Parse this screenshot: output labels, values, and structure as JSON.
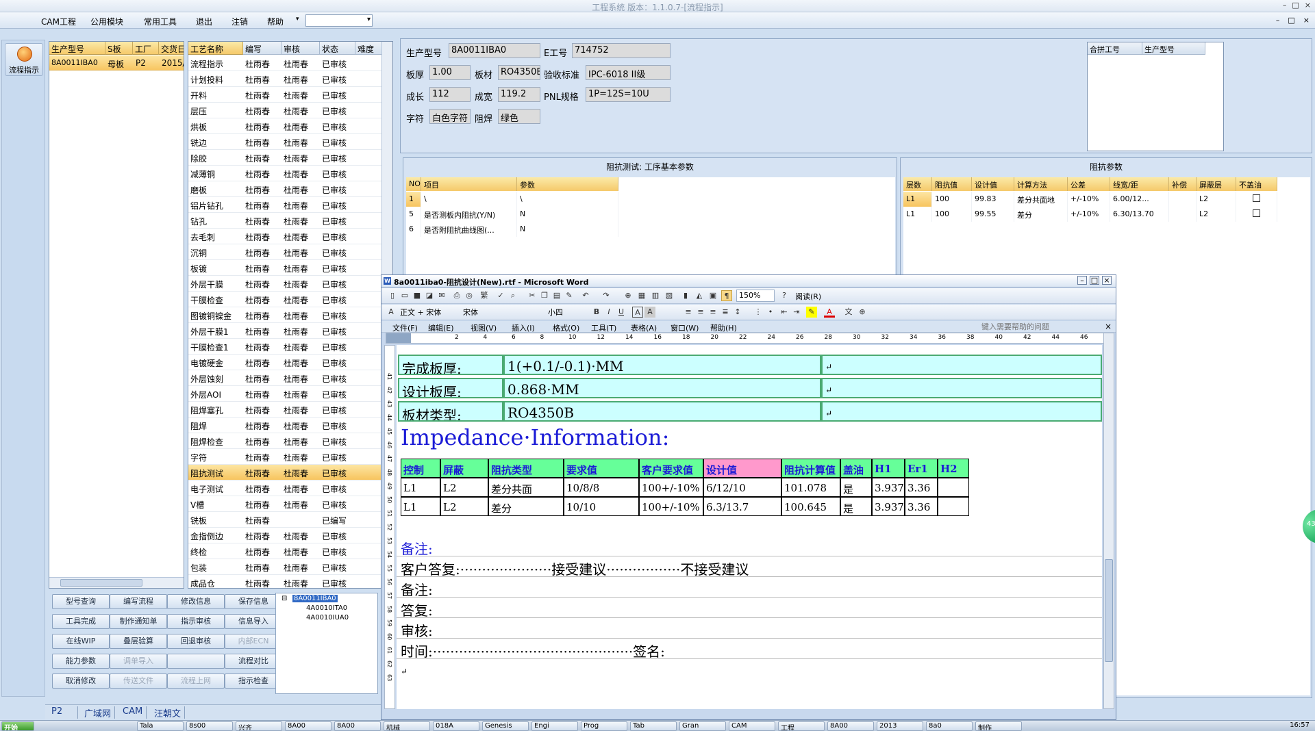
{
  "window": {
    "title": "工程系统 版本：1.1.0.7-[流程指示]",
    "controls": [
      "–",
      "□",
      "×"
    ]
  },
  "menu": {
    "items": [
      "CAM工程",
      "公用模块",
      "常用工具",
      "退出",
      "注销",
      "帮助"
    ],
    "combo_arrow": "▾",
    "mdi_controls": [
      "–",
      "□",
      "×"
    ]
  },
  "left_toolbar": {
    "flow_label": "流程指示"
  },
  "product_grid": {
    "headers": [
      "生产型号",
      "S板",
      "工厂",
      "交货日"
    ],
    "rows": [
      [
        "8A0011IBA0",
        "母板",
        "P2",
        "2015/"
      ]
    ]
  },
  "process_grid": {
    "headers": [
      "工艺名称",
      "编写",
      "审核",
      "状态",
      "难度"
    ],
    "rows": [
      [
        "流程指示",
        "杜雨春",
        "杜雨春",
        "已审核"
      ],
      [
        "计划投料",
        "杜雨春",
        "杜雨春",
        "已审核"
      ],
      [
        "开料",
        "杜雨春",
        "杜雨春",
        "已审核"
      ],
      [
        "层压",
        "杜雨春",
        "杜雨春",
        "已审核"
      ],
      [
        "烘板",
        "杜雨春",
        "杜雨春",
        "已审核"
      ],
      [
        "铣边",
        "杜雨春",
        "杜雨春",
        "已审核"
      ],
      [
        "除胶",
        "杜雨春",
        "杜雨春",
        "已审核"
      ],
      [
        "减薄铜",
        "杜雨春",
        "杜雨春",
        "已审核"
      ],
      [
        "磨板",
        "杜雨春",
        "杜雨春",
        "已审核"
      ],
      [
        "铝片钻孔",
        "杜雨春",
        "杜雨春",
        "已审核"
      ],
      [
        "钻孔",
        "杜雨春",
        "杜雨春",
        "已审核"
      ],
      [
        "去毛刺",
        "杜雨春",
        "杜雨春",
        "已审核"
      ],
      [
        "沉铜",
        "杜雨春",
        "杜雨春",
        "已审核"
      ],
      [
        "板镀",
        "杜雨春",
        "杜雨春",
        "已审核"
      ],
      [
        "外层干膜",
        "杜雨春",
        "杜雨春",
        "已审核"
      ],
      [
        "干膜检查",
        "杜雨春",
        "杜雨春",
        "已审核"
      ],
      [
        "图镀铜镍金",
        "杜雨春",
        "杜雨春",
        "已审核"
      ],
      [
        "外层干膜1",
        "杜雨春",
        "杜雨春",
        "已审核"
      ],
      [
        "干膜检查1",
        "杜雨春",
        "杜雨春",
        "已审核"
      ],
      [
        "电镀硬金",
        "杜雨春",
        "杜雨春",
        "已审核"
      ],
      [
        "外层蚀刻",
        "杜雨春",
        "杜雨春",
        "已审核"
      ],
      [
        "外层AOI",
        "杜雨春",
        "杜雨春",
        "已审核"
      ],
      [
        "阻焊塞孔",
        "杜雨春",
        "杜雨春",
        "已审核"
      ],
      [
        "阻焊",
        "杜雨春",
        "杜雨春",
        "已审核"
      ],
      [
        "阻焊检查",
        "杜雨春",
        "杜雨春",
        "已审核"
      ],
      [
        "字符",
        "杜雨春",
        "杜雨春",
        "已审核"
      ],
      [
        "阻抗测试",
        "杜雨春",
        "杜雨春",
        "已审核"
      ],
      [
        "电子测试",
        "杜雨春",
        "杜雨春",
        "已审核"
      ],
      [
        "V槽",
        "杜雨春",
        "杜雨春",
        "已审核"
      ],
      [
        "铣板",
        "杜雨春",
        "",
        "已编写"
      ],
      [
        "金指倒边",
        "杜雨春",
        "杜雨春",
        "已审核"
      ],
      [
        "终检",
        "杜雨春",
        "杜雨春",
        "已审核"
      ],
      [
        "包装",
        "杜雨春",
        "杜雨春",
        "已审核"
      ],
      [
        "成品仓",
        "杜雨春",
        "杜雨春",
        "已审核"
      ]
    ],
    "selected_index": 26
  },
  "buttons": [
    [
      "型号查询",
      "编写流程",
      "修改信息",
      "保存信息"
    ],
    [
      "工具完成",
      "制作通知单",
      "指示审核",
      "信息导入"
    ],
    [
      "在线WIP",
      "叠层验算",
      "回退审核",
      "内部ECN"
    ],
    [
      "能力参数",
      "调单导入",
      "",
      "流程对比"
    ],
    [
      "取消修改",
      "传送文件",
      "流程上网",
      "指示检查"
    ]
  ],
  "disabled_buttons": [
    "内部ECN",
    "调单导入",
    "",
    "传送文件",
    "流程上网"
  ],
  "tree": {
    "root": "8A0011IBA0",
    "children": [
      "4A0010ITA0",
      "4A0010IUA0"
    ],
    "toggle": "⊟"
  },
  "bottom_tabs": [
    "P2",
    "广域网",
    "CAM",
    "汪朝文"
  ],
  "info": {
    "product_label": "生产型号",
    "product_value": "8A0011IBA0",
    "eno_label": "E工号",
    "eno_value": "714752",
    "thickness_label": "板厚",
    "thickness_value": "1.00",
    "material_label": "板材",
    "material_value": "RO4350B",
    "std_label": "验收标准",
    "std_value": "IPC-6018 II级",
    "len_label": "成长",
    "len_value": "112",
    "wid_label": "成宽",
    "wid_value": "119.2",
    "pnl_label": "PNL规格",
    "pnl_value": "1P=12S=10U",
    "char_label": "字符",
    "char_value": "白色字符",
    "mask_label": "阻焊",
    "mask_value": "绿色"
  },
  "merge_grid": {
    "headers": [
      "合拼工号",
      "生产型号"
    ]
  },
  "base_params": {
    "title": "阻抗测试: 工序基本参数",
    "headers": [
      "NO",
      "项目",
      "参数"
    ],
    "rows": [
      [
        "1",
        "\\",
        "\\"
      ],
      [
        "5",
        "是否测板内阻抗(Y/N)",
        "N"
      ],
      [
        "6",
        "是否附阻抗曲线图(...",
        "N"
      ]
    ]
  },
  "impedance_params": {
    "title": "阻抗参数",
    "headers": [
      "层数",
      "阻抗值",
      "设计值",
      "计算方法",
      "公差",
      "线宽/距",
      "补偿",
      "屏蔽层",
      "不盖油"
    ],
    "rows": [
      [
        "L1",
        "100",
        "99.83",
        "差分共面地",
        "+/-10%",
        "6.00/12...",
        "",
        "L2"
      ],
      [
        "L1",
        "100",
        "99.55",
        "差分",
        "+/-10%",
        "6.30/13.70",
        "",
        "L2"
      ]
    ]
  },
  "word": {
    "title": "8a0011iba0-阻抗设计(New).rtf - Microsoft Word",
    "title_icon": "W",
    "controls": [
      "–",
      "□",
      "×"
    ],
    "zoom": "150%",
    "read_label": "阅读(R)",
    "style": "正文 + 宋体",
    "font": "宋体",
    "size": "小四",
    "fmt_buttons": [
      "B",
      "I",
      "U",
      "A",
      "A"
    ],
    "menus": [
      "文件(F)",
      "编辑(E)",
      "视图(V)",
      "插入(I)",
      "格式(O)",
      "工具(T)",
      "表格(A)",
      "窗口(W)",
      "帮助(H)"
    ],
    "help_placeholder": "键入需要帮助的问题",
    "close": "×",
    "ruler": [
      "2",
      "4",
      "6",
      "8",
      "10",
      "12",
      "14",
      "16",
      "18",
      "20",
      "22",
      "24",
      "26",
      "28",
      "30",
      "32",
      "34",
      "36",
      "38",
      "40",
      "42",
      "44",
      "46"
    ],
    "vruler": [
      "41",
      "42",
      "43",
      "44",
      "45",
      "46",
      "47",
      "48",
      "49",
      "50",
      "51",
      "52",
      "53",
      "54",
      "55",
      "56",
      "57",
      "58",
      "59",
      "60",
      "61",
      "62",
      "63"
    ],
    "doc": {
      "rows": [
        [
          "完成板厚:",
          "1(+0.1/-0.1)·MM"
        ],
        [
          "设计板厚:",
          "0.868·MM"
        ],
        [
          "板材类型:",
          "RO4350B"
        ]
      ],
      "mark": "↵",
      "heading": "Impedance·Information:",
      "imp_headers": [
        "控制",
        "屏蔽",
        "阻抗类型",
        "要求值",
        "客户要求值",
        "设计值",
        "阻抗计算值",
        "盖油",
        "H1",
        "Er1",
        "H2"
      ],
      "imp_rows": [
        [
          "L1",
          "L2",
          "差分共面",
          "10/8/8",
          "100+/-10%",
          "6/12/10",
          "101.078",
          "是",
          "3.937",
          "3.36",
          ""
        ],
        [
          "L1",
          "L2",
          "差分",
          "10/10",
          "100+/-10%",
          "6.3/13.7",
          "100.645",
          "是",
          "3.937",
          "3.36",
          ""
        ]
      ],
      "remark1": "备注:",
      "reply_line": "客户答复:·····················接受建议·················不接受建议",
      "remark2": "备注:",
      "answer": "答复:",
      "review": "审核:",
      "time_line": "时间:··············································签名:"
    }
  },
  "side_badge": "43",
  "taskbar": {
    "start": "开始",
    "items": [
      "Tala",
      "8s00",
      "兴齐",
      "8A00",
      "8A00",
      "机械",
      "018A",
      "Genesis",
      "Engi",
      "Prog",
      "Tab",
      "Gran",
      "CAM",
      "工程",
      "8A00",
      "2013",
      "8a0",
      "制作"
    ],
    "clock": "16:57"
  },
  "colors": {
    "accent": "#f7c45e",
    "grid_header": "#fbeaa8",
    "cell_fill": "#ccffff",
    "design_header": "#ff99cc",
    "heading_blue": "#1b1bd6"
  }
}
